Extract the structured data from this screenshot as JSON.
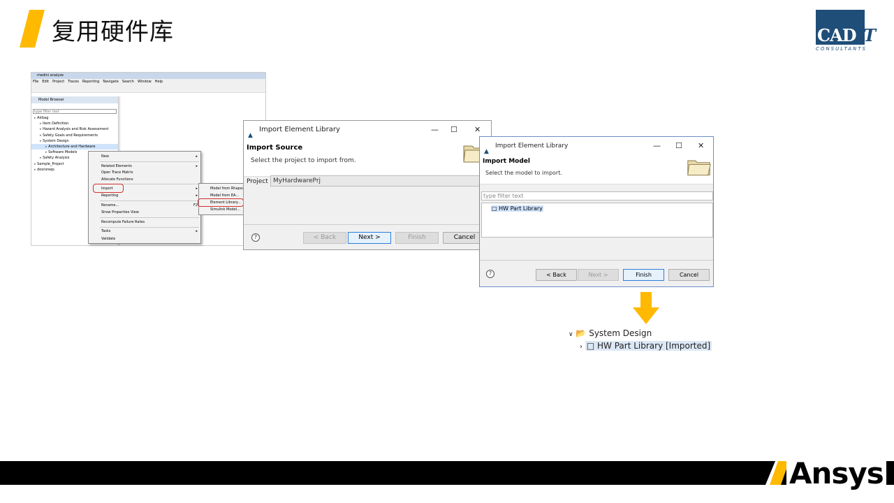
{
  "slide": {
    "title": "复用硬件库",
    "accent_color": "#ffb900"
  },
  "logo_cadit": {
    "main": "CAD",
    "it": "IT",
    "sub": "CONSULTANTS"
  },
  "logo_ansys": {
    "text": "Ansys"
  },
  "medini": {
    "window_title": "medini analyze",
    "menu": [
      "File",
      "Edit",
      "Project",
      "Traces",
      "Reporting",
      "Navigate",
      "Search",
      "Window",
      "Help"
    ],
    "browser_tab": "Model Browser",
    "filter_placeholder": "type filter text",
    "tree": [
      {
        "label": "Airbag",
        "indent": 0,
        "selected": false
      },
      {
        "label": "Item Definition",
        "indent": 1,
        "selected": false
      },
      {
        "label": "Hazard Analysis and Risk Assessment",
        "indent": 1,
        "selected": false
      },
      {
        "label": "Safety Goals and Requirements",
        "indent": 1,
        "selected": false
      },
      {
        "label": "System Design",
        "indent": 1,
        "selected": false
      },
      {
        "label": "Architecture and Hardware",
        "indent": 2,
        "selected": true
      },
      {
        "label": "Software Models",
        "indent": 2,
        "selected": false
      },
      {
        "label": "Safety Analysis",
        "indent": 1,
        "selected": false
      },
      {
        "label": "Sample_Project",
        "indent": 0,
        "selected": false
      },
      {
        "label": "doorsreqs",
        "indent": 0,
        "selected": false
      }
    ]
  },
  "context_menu": {
    "items": [
      {
        "label": "New",
        "submenu": true
      },
      {
        "label": "Related Elements",
        "submenu": true
      },
      {
        "label": "Open Trace Matrix",
        "submenu": false
      },
      {
        "label": "Allocate Functions",
        "submenu": false
      },
      {
        "label": "Import",
        "submenu": true
      },
      {
        "label": "Reporting",
        "submenu": true
      },
      {
        "label": "Rename...",
        "shortcut": "F2"
      },
      {
        "label": "Show Properties View"
      },
      {
        "label": "Recompute Failure Rates"
      },
      {
        "label": "Tasks",
        "submenu": true
      },
      {
        "label": "Validate"
      }
    ],
    "import_submenu": [
      "Model from Rhapsody...",
      "Model from EA...",
      "Element Library...",
      "Simulink Model..."
    ]
  },
  "dialog1": {
    "title": "Import Element Library",
    "heading": "Import Source",
    "subtitle": "Select the project to import from.",
    "project_label": "Project",
    "project_value": "MyHardwarePrj",
    "buttons": {
      "back": "< Back",
      "next": "Next >",
      "finish": "Finish",
      "cancel": "Cancel"
    }
  },
  "dialog2": {
    "title": "Import Element Library",
    "heading": "Import Model",
    "subtitle": "Select the model to import.",
    "filter_placeholder": "type filter text",
    "list_item": "HW Part Library",
    "buttons": {
      "back": "< Back",
      "next": "Next >",
      "finish": "Finish",
      "cancel": "Cancel"
    }
  },
  "result_tree": {
    "parent": "System Design",
    "child": "HW Part Library [Imported]"
  }
}
